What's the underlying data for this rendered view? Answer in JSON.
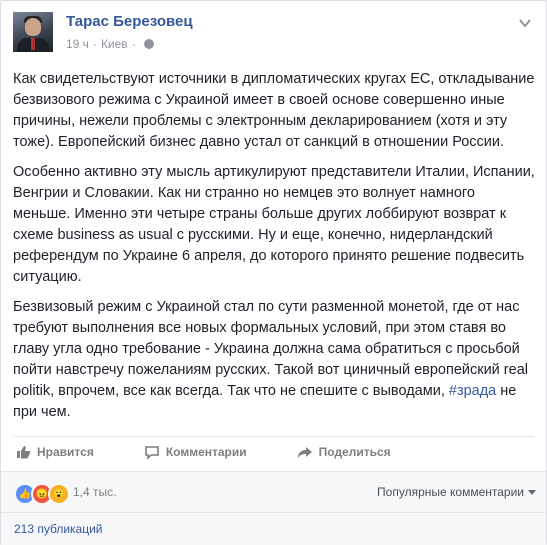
{
  "author": {
    "name": "Тарас Березовец",
    "time": "19 ч",
    "location": "Киев"
  },
  "post": {
    "paragraphs": [
      "Как свидетельствуют источники в дипломатических кругах ЕС, откладывание безвизового режима с Украиной имеет в своей основе совершенно иные причины, нежели проблемы с электронным декларированием (хотя и эту тоже). Европейский бизнес давно устал от санкций в отношении России.",
      "Особенно активно эту мысль артикулируют представители Италии, Испании, Венгрии и Словакии. Как ни странно но немцев это волнует намного меньше. Именно эти четыре страны больше других лоббируют возврат к схеме business as usual с русскими. Ну и еще, конечно, нидерландский референдум по Украине 6 апреля, до которого принято решение подвесить ситуацию.",
      "Безвизовый режим с Украиной стал по сути разменной монетой, где от нас требуют выполнения все новых формальных условий, при этом ставя во главу угла одно требование - Украина должна сама обратиться с просьбой пойти навстречу пожеланиям русских. Такой вот циничный европейский real politik, впрочем, все как всегда. Так что не спешите с выводами,"
    ],
    "hashtag": "#зрада",
    "tail": " не при чем."
  },
  "actions": {
    "like": "Нравится",
    "comment": "Комментарии",
    "share": "Поделиться"
  },
  "reactions": {
    "icons": [
      {
        "name": "like",
        "color": "#5890ff",
        "glyph": "👍"
      },
      {
        "name": "angry",
        "color": "#f0563f",
        "glyph": "😠"
      },
      {
        "name": "wow",
        "color": "#f7b125",
        "glyph": "😮"
      }
    ],
    "count": "1,4 тыс.",
    "sort_label": "Популярные комментарии"
  },
  "shares": {
    "label": "213 публикаций"
  }
}
